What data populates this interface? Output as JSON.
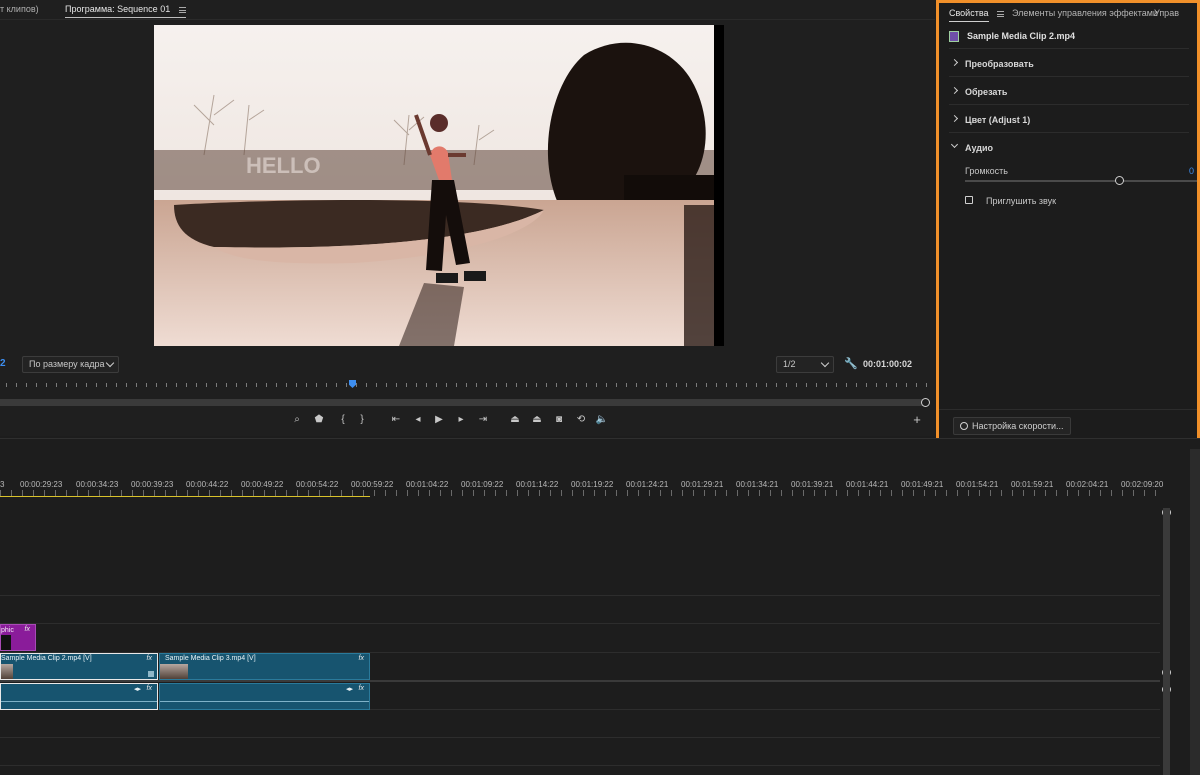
{
  "monitor": {
    "tabs": [
      {
        "label": "т клипов)"
      },
      {
        "label": "Программа: Sequence 01"
      }
    ],
    "left_edge_value": "2",
    "fit_select": "По размеру кадра",
    "resolution_select": "1/2",
    "timecode": "00:01:00:02"
  },
  "properties": {
    "tabs": [
      {
        "label": "Свойства"
      },
      {
        "label": "Элементы управления эффектами"
      },
      {
        "label": "Управ"
      }
    ],
    "clip_name": "Sample Media Clip 2.mp4",
    "sections": [
      {
        "label": "Преобразовать"
      },
      {
        "label": "Обрезать"
      },
      {
        "label": "Цвет (Adjust 1)"
      },
      {
        "label": "Аудио"
      }
    ],
    "volume_label": "Громкость",
    "volume_value": "0",
    "mute_label": "Приглушить звук",
    "speed_button": "Настройка скорости..."
  },
  "timeline": {
    "timecodes": [
      "3",
      "00:00:29:23",
      "00:00:34:23",
      "00:00:39:23",
      "00:00:44:22",
      "00:00:49:22",
      "00:00:54:22",
      "00:00:59:22",
      "00:01:04:22",
      "00:01:09:22",
      "00:01:14:22",
      "00:01:19:22",
      "00:01:24:21",
      "00:01:29:21",
      "00:01:34:21",
      "00:01:39:21",
      "00:01:44:21",
      "00:01:49:21",
      "00:01:54:21",
      "00:01:59:21",
      "00:02:04:21",
      "00:02:09:20"
    ],
    "graphic_clip": "phic",
    "clip2_video": "Sample Media Clip 2.mp4 [V]",
    "clip3_video": "Sample Media Clip 3.mp4 [V]",
    "fx": "fx"
  },
  "colors": {
    "accent_orange": "#f1902a",
    "clip_blue": "#17546f",
    "graphic_purple": "#8a1c9a",
    "playhead_blue": "#3d8ef0"
  }
}
